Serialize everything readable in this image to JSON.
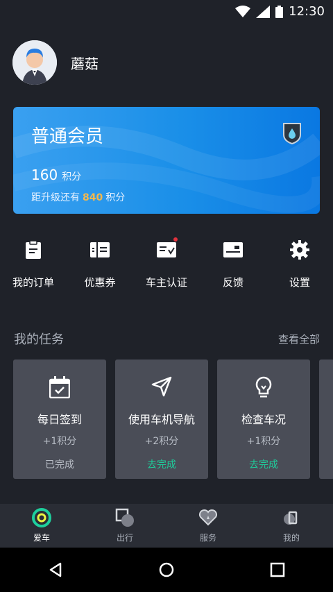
{
  "status_bar": {
    "time": "12:30"
  },
  "user": {
    "name": "蘑菇"
  },
  "membership": {
    "title": "普通会员",
    "points": "160",
    "points_unit": "积分",
    "upgrade_prefix": "距升级还有",
    "upgrade_value": "840",
    "upgrade_suffix": "积分"
  },
  "quick_menu": [
    {
      "label": "我的订单",
      "icon": "order-icon"
    },
    {
      "label": "优惠券",
      "icon": "coupon-icon"
    },
    {
      "label": "车主认证",
      "icon": "owner-verify-icon"
    },
    {
      "label": "反馈",
      "icon": "feedback-icon"
    },
    {
      "label": "设置",
      "icon": "settings-icon"
    }
  ],
  "tasks": {
    "title": "我的任务",
    "view_all": "查看全部",
    "items": [
      {
        "name": "每日签到",
        "reward": "+1积分",
        "status": "已完成",
        "icon": "calendar-check-icon"
      },
      {
        "name": "使用车机导航",
        "reward": "+2积分",
        "status": "去完成",
        "icon": "navigation-icon"
      },
      {
        "name": "检查车况",
        "reward": "+1积分",
        "status": "去完成",
        "icon": "lightbulb-icon"
      }
    ]
  },
  "bottom_nav": [
    {
      "label": "爱车",
      "icon": "car-icon",
      "active": true
    },
    {
      "label": "出行",
      "icon": "travel-icon"
    },
    {
      "label": "服务",
      "icon": "service-icon"
    },
    {
      "label": "我的",
      "icon": "profile-icon"
    }
  ],
  "colors": {
    "accent_green": "#1ecf9c",
    "highlight_orange": "#f6b84b",
    "card_blue": "#1a8fe8"
  }
}
